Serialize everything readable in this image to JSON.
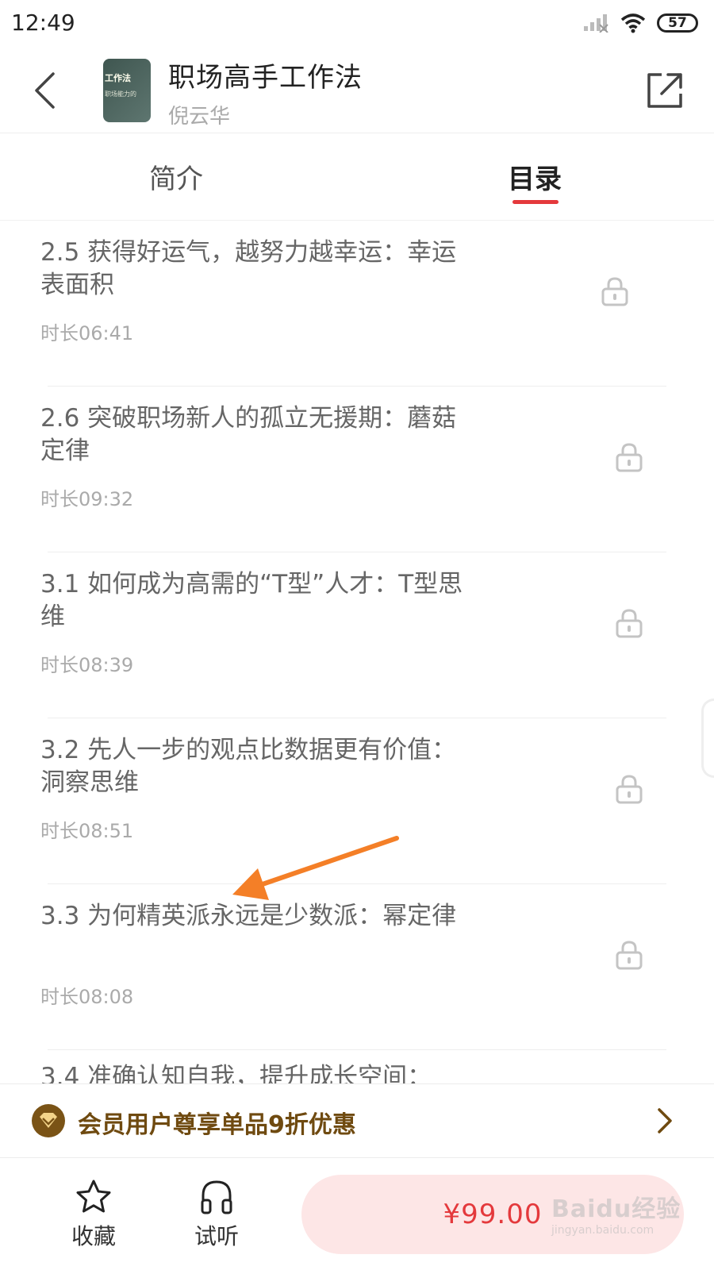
{
  "status_bar": {
    "time": "12:49",
    "battery": "57"
  },
  "header": {
    "cover_line1": "工作法",
    "cover_line2": "职场能力的",
    "title": "职场高手工作法",
    "author": "倪云华"
  },
  "tabs": [
    {
      "label": "简介",
      "active": false
    },
    {
      "label": "目录",
      "active": true
    }
  ],
  "accent_color": "#e4393c",
  "catalog": [
    {
      "title": "2.5 获得好运气，越努力越幸运：幸运表面积",
      "duration": "时长06:41",
      "locked": true
    },
    {
      "title": "2.6 突破职场新人的孤立无援期：蘑菇定律",
      "duration": "时长09:32",
      "locked": true
    },
    {
      "title": "3.1 如何成为高需的“T型”人才：T型思维",
      "duration": "时长08:39",
      "locked": true
    },
    {
      "title": "3.2 先人一步的观点比数据更有价值：洞察思维",
      "duration": "时长08:51",
      "locked": true
    },
    {
      "title": "3.3 为何精英派永远是少数派：幂定律",
      "duration": "时长08:08",
      "locked": true
    },
    {
      "title": "3.4 准确认知自我，提升成长空间：",
      "duration": "",
      "locked": true
    }
  ],
  "member_banner": {
    "text": "会员用户尊享单品9折优惠",
    "color": "#6f4a10"
  },
  "bottom_bar": {
    "favorite_label": "收藏",
    "listen_label": "试听",
    "price": "¥99.00"
  },
  "watermark": {
    "main": "Baidu经验",
    "sub": "jingyan.baidu.com"
  }
}
